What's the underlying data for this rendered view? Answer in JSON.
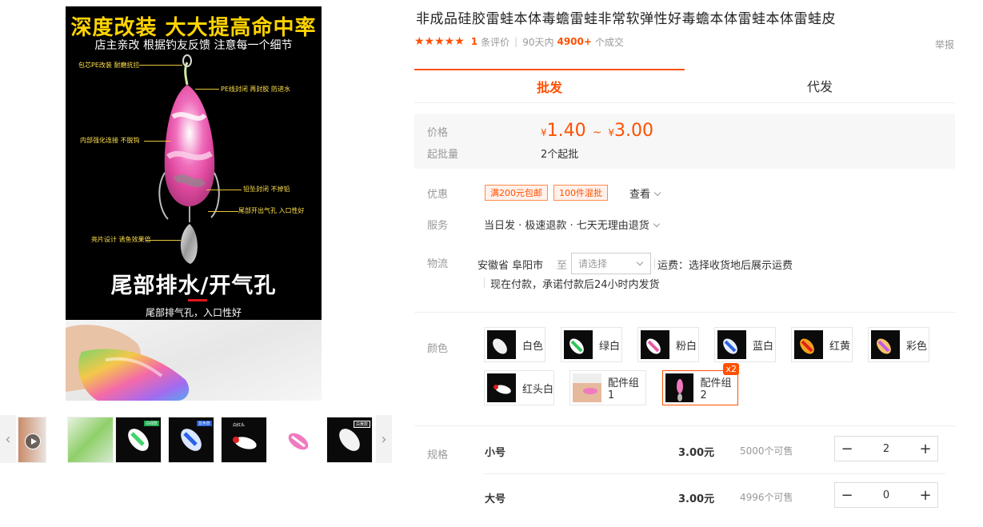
{
  "gallery": {
    "headline": "深度改装  大大提高命中率",
    "subhead": "店主亲改  根据钓友反馈  注意每一个细节",
    "notes": [
      "包芯PE改装  耐磨抗拉",
      "PE线封闭  再封胶  防进水",
      "内部强化连接  不脱钩",
      "铅坠封闭  不掉铅",
      "尾部开出气孔  入口性好",
      "亮片设计  诱鱼效果倍"
    ],
    "big_text": "尾部排水/开气孔",
    "sub_text": "尾部排气孔，入口性好",
    "thumb_tags": [
      "白绿款",
      "蓝色款",
      "白红头",
      "白黄款"
    ]
  },
  "product": {
    "title": "非成品硅胶雷蛙本体毒蟾雷蛙非常软弹性好毒蟾本体雷蛙本体雷蛙皮",
    "stars": "★★★★★",
    "review_count": "1",
    "review_label": "条评价",
    "period_label": "90天内",
    "sold_count": "4900+",
    "sold_label": "个成交",
    "report_label": "举报"
  },
  "tabs": [
    "批发",
    "代发"
  ],
  "price": {
    "label": "价格",
    "currency": "¥",
    "low": "1.40",
    "tilde": "~",
    "high": "3.00",
    "moq_label": "起批量",
    "moq_value": "2个起批"
  },
  "offers": {
    "label": "优惠",
    "coupons": [
      "满200元包邮",
      "100件混批"
    ],
    "more": "查看"
  },
  "service": {
    "label": "服务",
    "text": "当日发 · 极速退款 · 七天无理由退货"
  },
  "logistics": {
    "label": "物流",
    "from": "安徽省 阜阳市",
    "to_label": "至",
    "placeholder": "请选择",
    "freight": "运费：选择收货地后展示运费",
    "promise": "现在付款，承诺付款后24小时内发货"
  },
  "colors": {
    "label": "颜色",
    "options": [
      "白色",
      "绿白",
      "粉白",
      "蓝白",
      "红黄",
      "彩色",
      "红头白",
      "配件组1",
      "配件组2"
    ],
    "selected_badge": "x2"
  },
  "specs": {
    "label": "规格",
    "rows": [
      {
        "name": "小号",
        "price": "3.00元",
        "stock": "5000个可售",
        "qty": "2"
      },
      {
        "name": "大号",
        "price": "3.00元",
        "stock": "4996个可售",
        "qty": "0"
      }
    ],
    "minus": "−",
    "plus": "+"
  },
  "accent_color": "#ff5000"
}
